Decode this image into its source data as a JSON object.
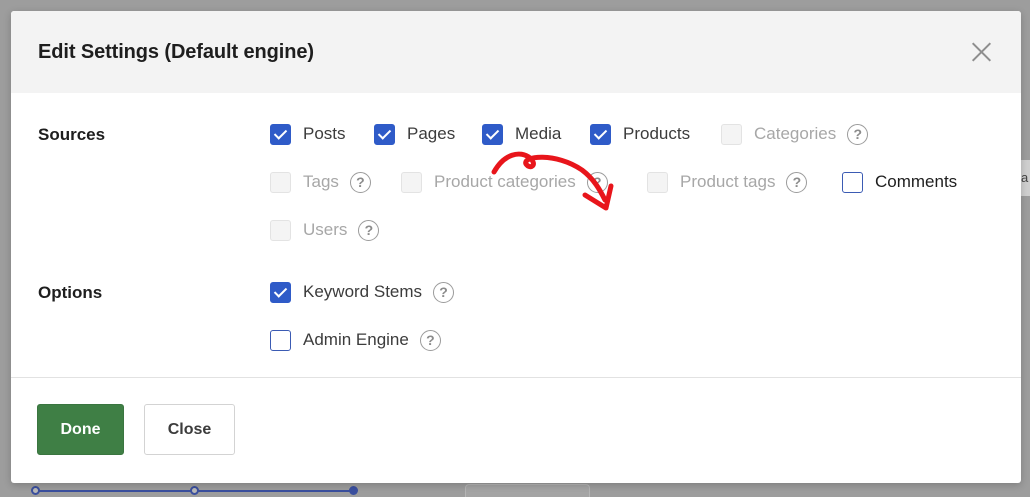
{
  "modal": {
    "title": "Edit Settings (Default engine)"
  },
  "sources": {
    "label": "Sources",
    "items": [
      {
        "label": "Posts",
        "state": "checked"
      },
      {
        "label": "Pages",
        "state": "checked"
      },
      {
        "label": "Media",
        "state": "checked"
      },
      {
        "label": "Products",
        "state": "checked"
      },
      {
        "label": "Categories",
        "state": "disabled"
      },
      {
        "label": "Tags",
        "state": "disabled"
      },
      {
        "label": "Product categories",
        "state": "disabled"
      },
      {
        "label": "Product tags",
        "state": "disabled"
      },
      {
        "label": "Comments",
        "state": "unchecked"
      },
      {
        "label": "Users",
        "state": "disabled"
      }
    ]
  },
  "options": {
    "label": "Options",
    "items": [
      {
        "label": "Keyword Stems",
        "state": "checked"
      },
      {
        "label": "Admin Engine",
        "state": "unchecked"
      }
    ]
  },
  "help_glyph": "?",
  "footer": {
    "done_label": "Done",
    "close_label": "Close"
  },
  "background": {
    "cut_text": "a"
  },
  "colors": {
    "accent_blue": "#2f5bc8",
    "done_green": "#3f7f45",
    "annotation_red": "#e8151b",
    "header_bg": "#f3f3f3"
  }
}
